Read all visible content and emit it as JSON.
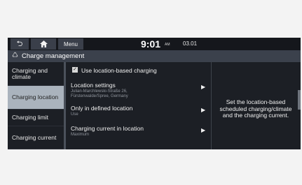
{
  "status_bar": {
    "back_icon": "back-arrow-icon",
    "home_icon": "home-icon",
    "menu_label": "Menu",
    "time": "9:01",
    "ampm": "AM",
    "date": "03.01"
  },
  "title_bar": {
    "icon": "charge-management-icon",
    "title": "Charge management"
  },
  "nav": {
    "items": [
      {
        "label": "Charging and climate",
        "selected": false
      },
      {
        "label": "Charging location",
        "selected": true
      },
      {
        "label": "Charging limit",
        "selected": false
      },
      {
        "label": "Charging current",
        "selected": false
      }
    ]
  },
  "content": {
    "checkbox_label": "Use location-based charging",
    "checkbox_checked": true,
    "rows": [
      {
        "title": "Location settings",
        "sub_line1": "Julian-Marchlewski-Straße 26,",
        "sub_line2": "Fürstenwalde/Spree, Germany"
      },
      {
        "title": "Only in defined location",
        "sub_line1": "Use"
      },
      {
        "title": "Charging current in location",
        "sub_line1": "Maximum"
      }
    ]
  },
  "info": {
    "line1": "Set the location-based",
    "line2": "scheduled charging/climate",
    "line3": "and the charging current."
  }
}
